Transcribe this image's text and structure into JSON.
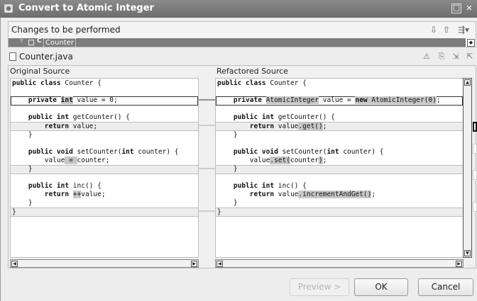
{
  "window": {
    "title": "Convert to Atomic Integer"
  },
  "changes": {
    "header_label": "Changes to be performed",
    "selected_item": "Counter"
  },
  "file": {
    "name": "Counter.java"
  },
  "compare": {
    "left_title": "Original Source",
    "right_title": "Refactored Source",
    "left_lines": [
      {
        "parts": [
          [
            "public class ",
            "kw"
          ],
          [
            "Counter {",
            ""
          ]
        ]
      },
      {
        "parts": []
      },
      {
        "parts": [
          [
            "    private ",
            "kw"
          ],
          [
            "int",
            "kw hl"
          ],
          [
            " value = 0;",
            ""
          ]
        ]
      },
      {
        "parts": []
      },
      {
        "parts": [
          [
            "    public int ",
            "kw"
          ],
          [
            "getCounter() {",
            ""
          ]
        ]
      },
      {
        "parts": [
          [
            "        return ",
            "kw"
          ],
          [
            "value;",
            ""
          ]
        ]
      },
      {
        "parts": [
          [
            "    }",
            ""
          ]
        ]
      },
      {
        "parts": []
      },
      {
        "parts": [
          [
            "    public void ",
            "kw"
          ],
          [
            "setCounter(",
            ""
          ],
          [
            "int ",
            "kw"
          ],
          [
            "counter) {",
            ""
          ]
        ]
      },
      {
        "parts": [
          [
            "        value",
            ""
          ],
          [
            " = ",
            "hl"
          ],
          [
            "counter;",
            ""
          ]
        ]
      },
      {
        "parts": [
          [
            "    }",
            ""
          ]
        ]
      },
      {
        "parts": []
      },
      {
        "parts": [
          [
            "    public int ",
            "kw"
          ],
          [
            "inc() {",
            ""
          ]
        ]
      },
      {
        "parts": [
          [
            "        return ",
            "kw"
          ],
          [
            "++",
            "hl"
          ],
          [
            "value;",
            ""
          ]
        ]
      },
      {
        "parts": [
          [
            "    }",
            ""
          ]
        ]
      },
      {
        "parts": [
          [
            "}",
            ""
          ]
        ]
      }
    ],
    "right_lines": [
      {
        "parts": [
          [
            "public class ",
            "kw"
          ],
          [
            "Counter {",
            ""
          ]
        ]
      },
      {
        "parts": []
      },
      {
        "parts": [
          [
            "    private ",
            "kw"
          ],
          [
            "AtomicInteger",
            "hl"
          ],
          [
            " value = ",
            ""
          ],
          [
            "new ",
            "kw hl"
          ],
          [
            "AtomicInteger(0)",
            "hl"
          ],
          [
            ";",
            ""
          ]
        ]
      },
      {
        "parts": []
      },
      {
        "parts": [
          [
            "    public int ",
            "kw"
          ],
          [
            "getCounter() {",
            ""
          ]
        ]
      },
      {
        "parts": [
          [
            "        return ",
            "kw"
          ],
          [
            "value",
            ""
          ],
          [
            ".get()",
            "hl"
          ],
          [
            ";",
            ""
          ]
        ]
      },
      {
        "parts": [
          [
            "    }",
            ""
          ]
        ]
      },
      {
        "parts": []
      },
      {
        "parts": [
          [
            "    public void ",
            "kw"
          ],
          [
            "setCounter(",
            ""
          ],
          [
            "int ",
            "kw"
          ],
          [
            "counter) {",
            ""
          ]
        ]
      },
      {
        "parts": [
          [
            "        value",
            ""
          ],
          [
            ".set(",
            "hl"
          ],
          [
            "counter",
            ""
          ],
          [
            ")",
            "hl"
          ],
          [
            ";",
            ""
          ]
        ]
      },
      {
        "parts": [
          [
            "    }",
            ""
          ]
        ]
      },
      {
        "parts": []
      },
      {
        "parts": [
          [
            "    public int ",
            "kw"
          ],
          [
            "inc() {",
            ""
          ]
        ]
      },
      {
        "parts": [
          [
            "        return ",
            "kw"
          ],
          [
            "value",
            ""
          ],
          [
            ".incrementAndGet()",
            "hl"
          ],
          [
            ";",
            ""
          ]
        ]
      },
      {
        "parts": [
          [
            "    }",
            ""
          ]
        ]
      },
      {
        "parts": [
          [
            "}",
            ""
          ]
        ]
      }
    ]
  },
  "buttons": {
    "preview": "Preview >",
    "ok": "OK",
    "cancel": "Cancel"
  },
  "icons": {
    "changes_toolbar": [
      "next-change-icon",
      "previous-change-icon",
      "filter-dropdown-icon"
    ],
    "compare_toolbar": [
      "ignore-whitespace-icon",
      "copy-left-to-right-icon",
      "next-difference-icon",
      "previous-difference-icon"
    ]
  }
}
